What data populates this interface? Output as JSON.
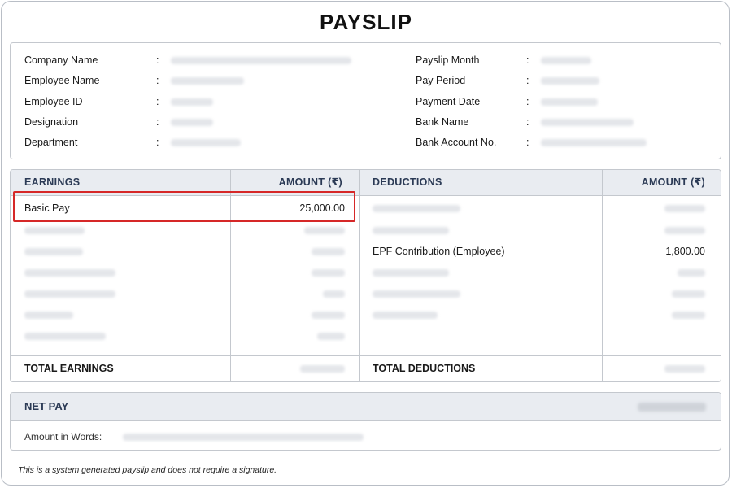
{
  "document": {
    "title": "PAYSLIP",
    "footer_note": "This is a system generated payslip and does not require a signature."
  },
  "employee_info": {
    "left": [
      {
        "label": "Company Name",
        "value": ""
      },
      {
        "label": "Employee Name",
        "value": ""
      },
      {
        "label": "Employee ID",
        "value": ""
      },
      {
        "label": "Designation",
        "value": ""
      },
      {
        "label": "Department",
        "value": ""
      }
    ],
    "right": [
      {
        "label": "Payslip Month",
        "value": ""
      },
      {
        "label": "Pay Period",
        "value": ""
      },
      {
        "label": "Payment Date",
        "value": ""
      },
      {
        "label": "Bank Name",
        "value": ""
      },
      {
        "label": "Bank Account No.",
        "value": ""
      }
    ],
    "separator": ":"
  },
  "table": {
    "headers": {
      "earnings": "EARNINGS",
      "earnings_amount": "AMOUNT (₹)",
      "deductions": "DEDUCTIONS",
      "deductions_amount": "AMOUNT (₹)"
    },
    "earnings": [
      {
        "label": "Basic Pay",
        "amount": "25,000.00",
        "redacted": false
      },
      {
        "label": "",
        "amount": "",
        "redacted": true
      },
      {
        "label": "",
        "amount": "",
        "redacted": true
      },
      {
        "label": "",
        "amount": "",
        "redacted": true
      },
      {
        "label": "",
        "amount": "",
        "redacted": true
      },
      {
        "label": "",
        "amount": "",
        "redacted": true
      },
      {
        "label": "",
        "amount": "",
        "redacted": true
      }
    ],
    "deductions": [
      {
        "label": "",
        "amount": "",
        "redacted": true
      },
      {
        "label": "",
        "amount": "",
        "redacted": true
      },
      {
        "label": "EPF Contribution (Employee)",
        "amount": "1,800.00",
        "redacted": false
      },
      {
        "label": "",
        "amount": "",
        "redacted": true
      },
      {
        "label": "",
        "amount": "",
        "redacted": true
      },
      {
        "label": "",
        "amount": "",
        "redacted": true
      }
    ],
    "totals": {
      "earnings_label": "TOTAL EARNINGS",
      "earnings_value": "",
      "deductions_label": "TOTAL DEDUCTIONS",
      "deductions_value": ""
    },
    "highlighted_row": "Basic Pay",
    "highlight_color": "#d62828"
  },
  "net_pay": {
    "label": "NET PAY",
    "value": "",
    "words_label": "Amount in Words:",
    "words_value": ""
  },
  "colors": {
    "header_bg": "#e9ecf1",
    "header_text": "#2b3a55",
    "border": "#c4c8ce"
  }
}
